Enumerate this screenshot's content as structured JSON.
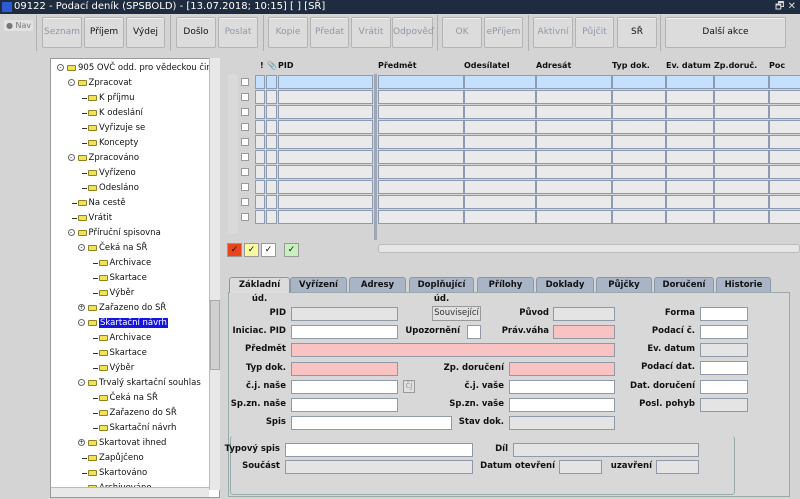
{
  "window": {
    "title": "09122 - Podací deník (SPSBOLD) - [13.07.2018; 10:15]  [ ]  [SŘ]",
    "controls": "🗗 ✕",
    "logo": "V"
  },
  "nav": {
    "label": "Nav"
  },
  "toolbar": [
    {
      "label": "Seznam",
      "enabled": false
    },
    {
      "label": "Příjem",
      "enabled": true
    },
    {
      "label": "Výdej",
      "enabled": true
    },
    {
      "label": "Došlo",
      "enabled": true
    },
    {
      "label": "Poslat",
      "enabled": false
    },
    {
      "label": "Kopie",
      "enabled": false
    },
    {
      "label": "Předat",
      "enabled": false
    },
    {
      "label": "Vrátit",
      "enabled": false
    },
    {
      "label": "Odpověď",
      "enabled": false
    },
    {
      "label": "OK",
      "enabled": false
    },
    {
      "label": "ePříjem",
      "enabled": false
    },
    {
      "label": "Aktivní",
      "enabled": false
    },
    {
      "label": "Půjčit",
      "enabled": false
    },
    {
      "label": "SŘ",
      "enabled": true
    },
    {
      "label": "Další akce",
      "enabled": true
    }
  ],
  "tree": [
    {
      "label": "905 OVČ odd. pro vědeckou činnost",
      "level": 0,
      "exp": "-"
    },
    {
      "label": "Zpracovat",
      "level": 1,
      "exp": "-"
    },
    {
      "label": "K příjmu",
      "level": 2
    },
    {
      "label": "K odeslání",
      "level": 2
    },
    {
      "label": "Vyřizuje se",
      "level": 2
    },
    {
      "label": "Koncepty",
      "level": 2
    },
    {
      "label": "Zpracováno",
      "level": 1,
      "exp": "-"
    },
    {
      "label": "Vyřízeno",
      "level": 2
    },
    {
      "label": "Odesláno",
      "level": 2
    },
    {
      "label": "Na cestě",
      "level": 1
    },
    {
      "label": "Vrátit",
      "level": 1
    },
    {
      "label": "Příruční spisovna",
      "level": 1,
      "exp": "-"
    },
    {
      "label": "Čeká na SŘ",
      "level": 2,
      "exp": "-"
    },
    {
      "label": "Archivace",
      "level": 3
    },
    {
      "label": "Skartace",
      "level": 3
    },
    {
      "label": "Výběr",
      "level": 3
    },
    {
      "label": "Zařazeno do SŘ",
      "level": 2,
      "exp": "+"
    },
    {
      "label": "Skartační návrh",
      "level": 2,
      "exp": "-",
      "selected": true
    },
    {
      "label": "Archivace",
      "level": 3
    },
    {
      "label": "Skartace",
      "level": 3
    },
    {
      "label": "Výběr",
      "level": 3
    },
    {
      "label": "Trvalý skartační souhlas",
      "level": 2,
      "exp": "-"
    },
    {
      "label": "Čeká na SŘ",
      "level": 3
    },
    {
      "label": "Zařazeno do SŘ",
      "level": 3
    },
    {
      "label": "Skartační návrh",
      "level": 3
    },
    {
      "label": "Skartovat ihned",
      "level": 2,
      "exp": "+"
    },
    {
      "label": "Zapůjčeno",
      "level": 2
    },
    {
      "label": "Skartováno",
      "level": 2
    },
    {
      "label": "Archivováno",
      "level": 2
    }
  ],
  "grid": {
    "columns": [
      "!",
      "📎",
      "PID",
      "Předmět",
      "Odesílatel",
      "Adresát",
      "Typ dok.",
      "Ev. datum",
      "Zp.doruč.",
      "Poc"
    ],
    "row_count": 10
  },
  "filters": [
    {
      "color": "#e8451c",
      "mark": "✓"
    },
    {
      "color": "#fafaa0",
      "mark": "✓"
    },
    {
      "color": "#ffffff",
      "mark": "✓"
    },
    {
      "color": "#c8f0c0",
      "mark": "✓"
    }
  ],
  "tabs": [
    "Základní úd.",
    "Vyřízení",
    "Adresy",
    "Doplňující úd.",
    "Přílohy",
    "Doklady",
    "Půjčky",
    "Doručení",
    "Historie"
  ],
  "form": {
    "pid": "PID",
    "souvisejici": "Související",
    "puvod": "Původ",
    "forma": "Forma",
    "iniciac_pid": "Iniciac. PID",
    "upozorneni": "Upozornění",
    "prav_vaha": "Práv.váha",
    "podaci_c": "Podací č.",
    "predmet": "Předmět",
    "ev_datum": "Ev. datum",
    "typ_dok": "Typ dok.",
    "zp_doruceni": "Zp. doručení",
    "podaci_dat": "Podací dat.",
    "cj_nase": "č.j. naše",
    "cj_button": "čj",
    "cj_vase": "č.j. vaše",
    "dat_doruceni": "Dat. doručení",
    "spzn_nase": "Sp.zn. naše",
    "spzn_vase": "Sp.zn. vaše",
    "posl_pohyb": "Posl. pohyb",
    "spis": "Spis",
    "stav_dok": "Stav dok.",
    "typovy_spis": "Typový spis",
    "dil": "Díl",
    "soucast": "Součást",
    "datum_otevreni": "Datum otevření",
    "uzavreni": "uzavření"
  }
}
